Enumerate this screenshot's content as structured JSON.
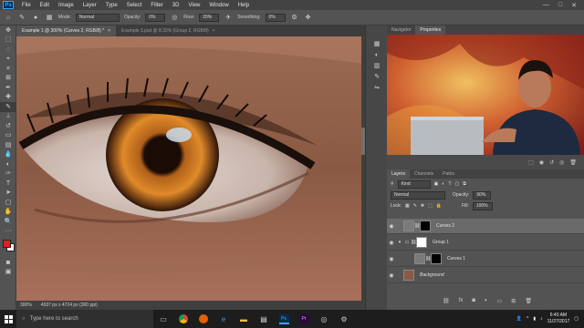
{
  "menu": {
    "logo": "Ps",
    "items": [
      "File",
      "Edit",
      "Image",
      "Layer",
      "Type",
      "Select",
      "Filter",
      "3D",
      "View",
      "Window",
      "Help"
    ],
    "window_controls": [
      "—",
      "□",
      "✕"
    ]
  },
  "options": {
    "mode_label": "Mode:",
    "mode_value": "Normal",
    "opacity_label": "Opacity:",
    "opacity_value": "0%",
    "flow_label": "Flow:",
    "flow_value": "20%",
    "smoothing_label": "Smoothing:",
    "smoothing_value": "0%"
  },
  "tabs": [
    {
      "label": "Example 1 @ 300% (Curves 2, RGB/8) *",
      "close": "×"
    },
    {
      "label": "Example 3.psd @ 8.33% (Group 2, RGB/8)",
      "close": "×"
    }
  ],
  "status": {
    "zoom": "300%",
    "doc_info": "4937 px x 4724 px (300 ppi)"
  },
  "panels": {
    "top_tabs": [
      "Navigator",
      "Properties"
    ],
    "layers_tabs": [
      "Layers",
      "Channels",
      "Paths"
    ],
    "kind_label": "Kind",
    "blend_mode": "Normal",
    "opacity_label": "Opacity:",
    "opacity_value": "90%",
    "lock_label": "Lock:",
    "fill_label": "Fill:",
    "fill_value": "100%"
  },
  "layers": [
    {
      "name": "Curves 2",
      "selected": true
    },
    {
      "name": "Group 1",
      "selected": false
    },
    {
      "name": "Curves 1",
      "selected": false
    },
    {
      "name": "Background",
      "selected": false
    }
  ],
  "taskbar": {
    "search_placeholder": "Type here to search",
    "time": "6:40 AM",
    "date": "11/27/2017",
    "apps": [
      "task-view",
      "chrome",
      "firefox",
      "edge",
      "explorer",
      "store",
      "photoshop",
      "premiere",
      "obs",
      "steam"
    ]
  },
  "colors": {
    "accent": "#31a8ff",
    "foreground_swatch": "#e02020",
    "background_swatch": "#ffffff"
  }
}
